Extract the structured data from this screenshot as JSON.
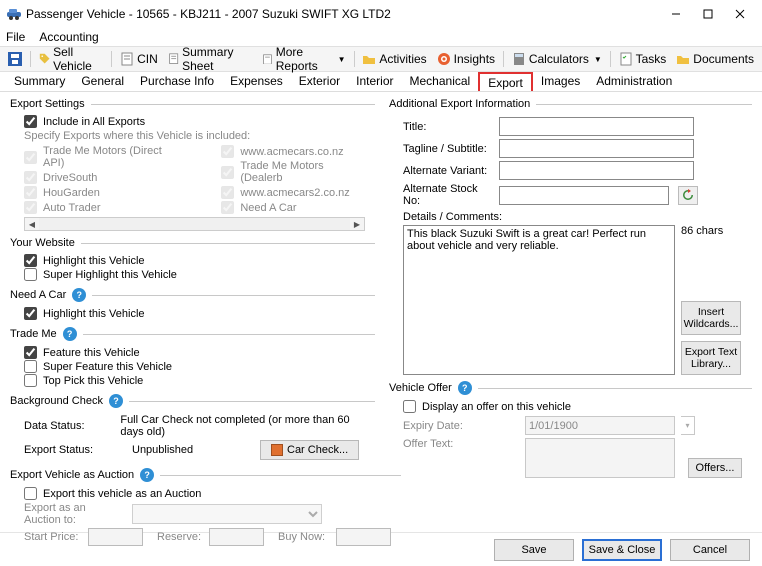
{
  "window": {
    "title": "Passenger Vehicle - 10565 - KBJ211 - 2007 Suzuki SWIFT XG LTD2"
  },
  "menu": {
    "file": "File",
    "accounting": "Accounting"
  },
  "toolbar": {
    "save": "",
    "sell": "Sell Vehicle",
    "cin": "CIN",
    "summary": "Summary Sheet",
    "more": "More Reports",
    "activities": "Activities",
    "insights": "Insights",
    "calculators": "Calculators",
    "tasks": "Tasks",
    "documents": "Documents"
  },
  "tabs": {
    "summary": "Summary",
    "general": "General",
    "purchase": "Purchase Info",
    "expenses": "Expenses",
    "exterior": "Exterior",
    "interior": "Interior",
    "mechanical": "Mechanical",
    "export": "Export",
    "images": "Images",
    "admin": "Administration"
  },
  "exportSettings": {
    "legend": "Export Settings",
    "includeAll": "Include in All Exports",
    "specifyHint": "Specify Exports where this Vehicle is included:",
    "leftList": [
      "Trade Me Motors (Direct API)",
      "DriveSouth",
      "HouGarden",
      "Auto Trader"
    ],
    "rightList": [
      "www.acmecars.co.nz",
      "Trade Me Motors (Dealerb",
      "www.acmecars2.co.nz",
      "Need A Car"
    ]
  },
  "yourWebsite": {
    "legend": "Your Website",
    "highlight": "Highlight this Vehicle",
    "superHighlight": "Super Highlight this Vehicle"
  },
  "needACar": {
    "legend": "Need A Car",
    "highlight": "Highlight this Vehicle"
  },
  "tradeMe": {
    "legend": "Trade Me",
    "feature": "Feature this Vehicle",
    "superFeature": "Super Feature this Vehicle",
    "topPick": "Top Pick this Vehicle"
  },
  "bgCheck": {
    "legend": "Background Check",
    "dataStatusLbl": "Data Status:",
    "dataStatusVal": "Full Car Check not completed (or more than 60 days old)",
    "exportStatusLbl": "Export Status:",
    "exportStatusVal": "Unpublished",
    "carCheckBtn": "Car Check..."
  },
  "auction": {
    "legend": "Export Vehicle as Auction",
    "exportAs": "Export this vehicle as an Auction",
    "exportTo": "Export as an Auction to:",
    "startPrice": "Start Price:",
    "reserve": "Reserve:",
    "buyNow": "Buy Now:"
  },
  "addlInfo": {
    "legend": "Additional Export Information",
    "title": "Title:",
    "tagline": "Tagline / Subtitle:",
    "variant": "Alternate Variant:",
    "stockNo": "Alternate Stock No:",
    "titleVal": "",
    "taglineVal": "",
    "variantVal": "",
    "stockNoVal": "",
    "detailsLbl": "Details / Comments:",
    "detailsVal": "This black Suzuki Swift is a great car! Perfect run about vehicle and very reliable.",
    "charCount": "86 chars",
    "insertWildcards": "Insert Wildcards...",
    "exportTextLib": "Export Text Library..."
  },
  "offer": {
    "legend": "Vehicle Offer",
    "display": "Display an offer on this vehicle",
    "expiryLbl": "Expiry Date:",
    "expiryVal": "1/01/1900",
    "offerTextLbl": "Offer Text:",
    "offersBtn": "Offers..."
  },
  "footer": {
    "save": "Save",
    "saveClose": "Save & Close",
    "cancel": "Cancel"
  }
}
